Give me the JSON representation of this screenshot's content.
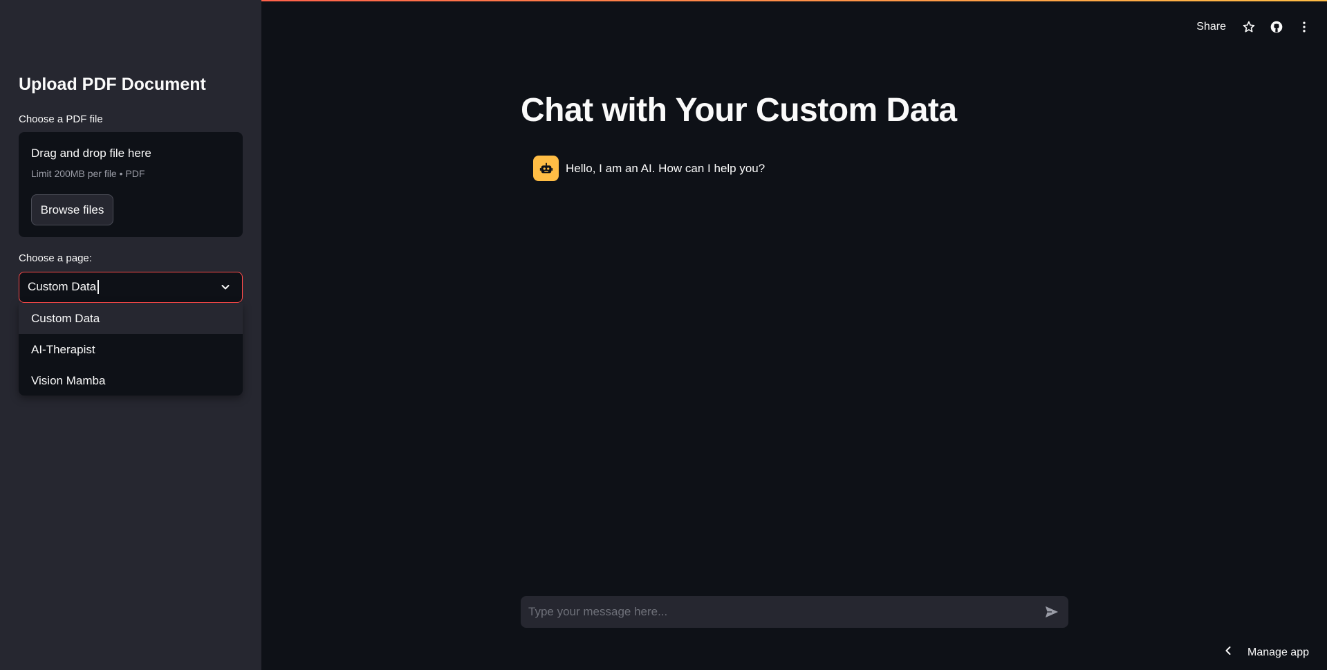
{
  "sidebar": {
    "title": "Upload PDF Document",
    "uploader": {
      "label": "Choose a PDF file",
      "drop_text": "Drag and drop file here",
      "limit_text": "Limit 200MB per file • PDF",
      "browse_label": "Browse files"
    },
    "page_select": {
      "label": "Choose a page:",
      "value": "Custom Data",
      "options": [
        "Custom Data",
        "AI-Therapist",
        "Vision Mamba"
      ]
    }
  },
  "header": {
    "share_label": "Share",
    "icons": [
      "star-icon",
      "github-icon",
      "more-vertical-icon"
    ]
  },
  "main": {
    "title": "Chat with Your Custom Data",
    "messages": [
      {
        "role": "assistant",
        "avatar_icon": "robot-icon",
        "text": "Hello, I am an AI. How can I help you?"
      }
    ],
    "input_placeholder": "Type your message here..."
  },
  "footer": {
    "manage_label": "Manage app"
  },
  "colors": {
    "background": "#0e1117",
    "sidebar": "#262730",
    "accent": "#ff4b4b",
    "avatar": "#ffbd45"
  }
}
